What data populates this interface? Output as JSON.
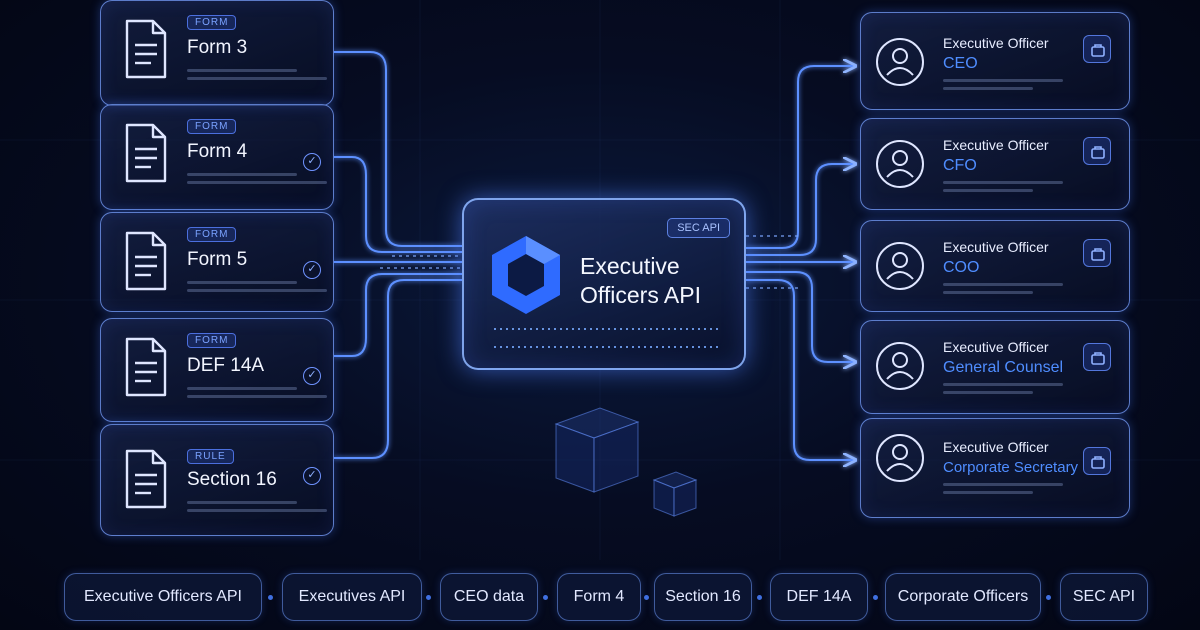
{
  "sources": [
    {
      "tag": "FORM",
      "title": "Form 3",
      "checked": false
    },
    {
      "tag": "FORM",
      "title": "Form 4",
      "checked": true
    },
    {
      "tag": "FORM",
      "title": "Form 5",
      "checked": true
    },
    {
      "tag": "FORM",
      "title": "DEF 14A",
      "checked": true
    },
    {
      "tag": "RULE",
      "title": "Section 16",
      "checked": true
    }
  ],
  "hub": {
    "tag": "SEC API",
    "title": "Executive Officers API"
  },
  "targets": [
    {
      "role": "Executive Officer",
      "name": "CEO"
    },
    {
      "role": "Executive Officer",
      "name": "CFO"
    },
    {
      "role": "Executive Officer",
      "name": "COO"
    },
    {
      "role": "Executive Officer",
      "name": "General Counsel"
    },
    {
      "role": "Executive Officer",
      "name": "Corporate Secretary"
    }
  ],
  "pills": [
    "Executive Officers API",
    "Executives API",
    "CEO data",
    "Form 4",
    "Section 16",
    "DEF 14A",
    "Corporate Officers",
    "SEC API"
  ],
  "colors": {
    "accent": "#4f8dff",
    "glow": "#5a8cff",
    "background": "#050a1e"
  },
  "icons": {
    "source": "document-icon",
    "check": "check-circle-icon",
    "hub": "hexagon-logo-icon",
    "target": "user-avatar-icon",
    "badge": "briefcase-icon"
  }
}
